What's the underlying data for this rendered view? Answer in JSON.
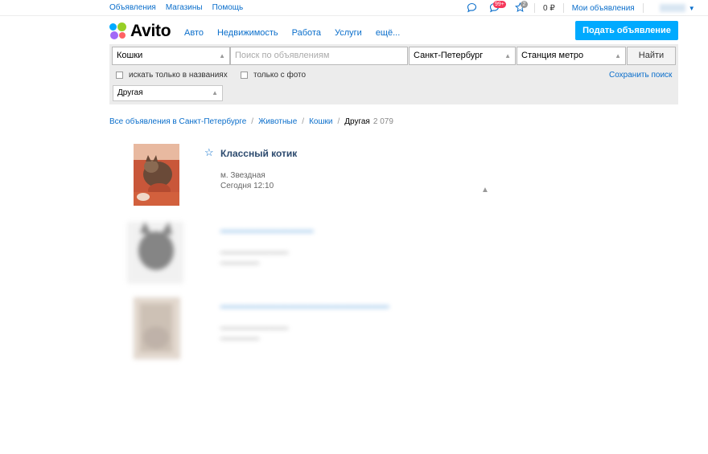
{
  "topbar": {
    "links": [
      "Объявления",
      "Магазины",
      "Помощь"
    ],
    "notif_badge": "99+",
    "fav_badge": "2",
    "balance": "0 ₽",
    "my_ads": "Мои объявления"
  },
  "header": {
    "logo": "Avito",
    "nav": [
      "Авто",
      "Недвижимость",
      "Работа",
      "Услуги",
      "ещё..."
    ],
    "post_ad": "Подать объявление"
  },
  "search": {
    "category": "Кошки",
    "query_placeholder": "Поиск по объявлениям",
    "city": "Санкт-Петербург",
    "metro": "Станция метро",
    "find": "Найти",
    "only_titles": "искать только в названиях",
    "only_photo": "только с фото",
    "save": "Сохранить поиск",
    "breed": "Другая"
  },
  "breadcrumb": {
    "items": [
      "Все объявления в Санкт-Петербурге",
      "Животные",
      "Кошки"
    ],
    "current": "Другая",
    "count": "2 079"
  },
  "listings": [
    {
      "title": "Классный котик",
      "metro": "м. Звездная",
      "date": "Сегодня 12:10"
    }
  ],
  "colors": {
    "accent": "#00aaff",
    "link": "#0a6ecb",
    "badge": "#f5375a"
  }
}
